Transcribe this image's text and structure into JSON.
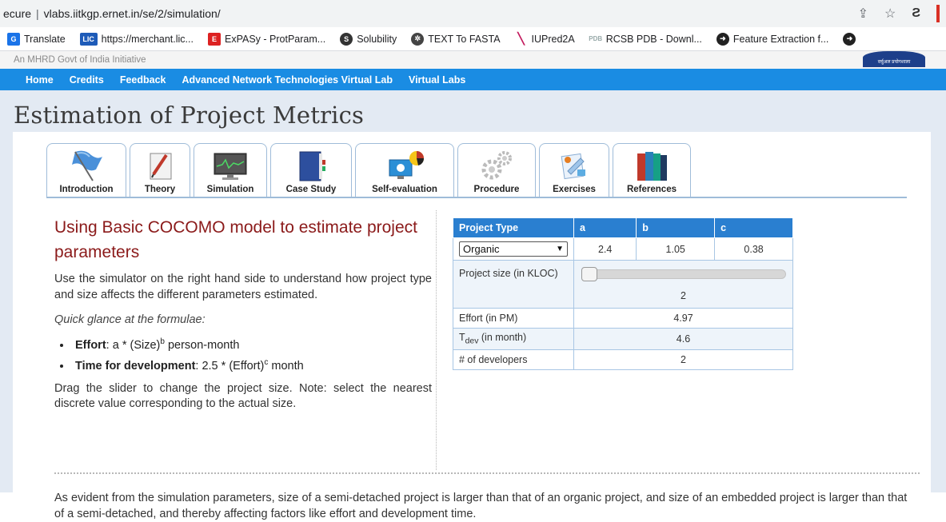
{
  "browser": {
    "url_prefix": "ecure",
    "url": "vlabs.iitkgp.ernet.in/se/2/simulation/",
    "bookmarks": [
      {
        "label": "Translate",
        "icon": "translate-icon",
        "color": "#1a73e8"
      },
      {
        "label": "https://merchant.lic...",
        "icon": "merchant-icon",
        "color": "#1e5bb8"
      },
      {
        "label": "ExPASy - ProtParam...",
        "icon": "expasy-icon",
        "color": "#d22"
      },
      {
        "label": "Solubility",
        "icon": "solubility-icon",
        "color": "#333"
      },
      {
        "label": "TEXT To FASTA",
        "icon": "fasta-icon",
        "color": "#444"
      },
      {
        "label": "IUPred2A",
        "icon": "iupred-icon",
        "color": "#c2185b"
      },
      {
        "label": "RCSB PDB - Downl...",
        "icon": "rcsb-icon",
        "color": "#9aa"
      },
      {
        "label": "Feature Extraction f...",
        "icon": "feature-icon",
        "color": "#222"
      }
    ]
  },
  "site": {
    "gov_text": "An MHRD Govt of India Initiative",
    "nav": [
      "Home",
      "Credits",
      "Feedback",
      "Advanced Network Technologies Virtual Lab",
      "Virtual Labs"
    ],
    "page_title": "Estimation of Project Metrics"
  },
  "tabs": [
    {
      "label": "Introduction",
      "icon": "flag-icon"
    },
    {
      "label": "Theory",
      "icon": "pen-paper-icon"
    },
    {
      "label": "Simulation",
      "icon": "monitor-graph-icon"
    },
    {
      "label": "Case Study",
      "icon": "book-icon"
    },
    {
      "label": "Self-evaluation",
      "icon": "computer-chart-icon"
    },
    {
      "label": "Procedure",
      "icon": "gears-icon"
    },
    {
      "label": "Exercises",
      "icon": "exercises-icon"
    },
    {
      "label": "References",
      "icon": "books-icon"
    }
  ],
  "left": {
    "heading": "Using Basic COCOMO model to estimate project parameters",
    "intro": "Use the simulator on the right hand side to understand how project type and size affects the different parameters estimated.",
    "glance": "Quick glance at the formulae:",
    "effort_label": "Effort",
    "effort_formula": ": a * (Size)",
    "effort_sup": "b",
    "effort_unit": " person-month",
    "tdev_label": "Time for development",
    "tdev_formula": ": 2.5 * (Effort)",
    "tdev_sup": "c",
    "tdev_unit": " month",
    "drag_note": "Drag the slider to change the project size. Note: select the nearest discrete value corresponding to the actual size."
  },
  "table": {
    "headers": [
      "Project Type",
      "a",
      "b",
      "c"
    ],
    "project_type": "Organic",
    "a": "2.4",
    "b": "1.05",
    "c": "0.38",
    "size_label": "Project size (in KLOC)",
    "size_value": "2",
    "slider_fraction": 0.0,
    "effort_label": "Effort (in PM)",
    "effort_value": "4.97",
    "tdev_label_main": "T",
    "tdev_label_sub": "dev",
    "tdev_label_rest": " (in month)",
    "tdev_value": "4.6",
    "devs_label": "# of developers",
    "devs_value": "2"
  },
  "bottom": {
    "text": "As evident from the simulation parameters, size of a semi-detached project is larger than that of an organic project, and size of an embedded project is larger than that of a semi-detached, and thereby affecting factors like effort and development time."
  },
  "colors": {
    "nav_bg": "#1a8ce3",
    "table_header": "#2a7fd0",
    "heading": "#8b1a1a"
  }
}
